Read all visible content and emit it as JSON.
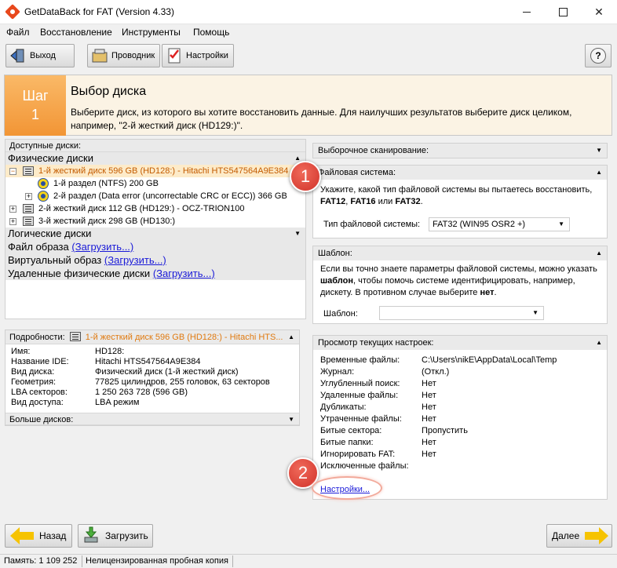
{
  "window": {
    "title": "GetDataBack for FAT (Version 4.33)"
  },
  "menu": [
    "Файл",
    "Восстановление",
    "Инструменты",
    "Помощь"
  ],
  "toolbar": {
    "exit_label": "Выход",
    "explorer_label": "Проводник",
    "settings_label": "Настройки",
    "help_label": "?"
  },
  "step": {
    "word": "Шаг",
    "number": "1",
    "title": "Выбор диска",
    "description": "Выберите диск, из которого вы хотите восстановить данные. Для наилучших результатов выберите диск целиком, например, \"2-й жесткий диск (HD129:)\"."
  },
  "disks": {
    "header": "Доступные диски:",
    "physical_header": "Физические диски",
    "items": [
      {
        "label": "1-й жесткий диск 596 GB (HD128:) - Hitachi HTS547564A9E384",
        "expander": "−"
      },
      {
        "label": "1-й раздел (NTFS) 200 GB"
      },
      {
        "label": "2-й раздел (Data error (uncorrectable CRC or ECC)) 366 GB",
        "expander": "+"
      },
      {
        "label": "2-й жесткий диск 112 GB (HD129:) - OCZ-TRION100",
        "expander": "+"
      },
      {
        "label": "3-й жесткий диск 298 GB (HD130:)",
        "expander": "+"
      }
    ],
    "logical_header": "Логические диски",
    "image_file_label": "Файл образа",
    "image_file_link": "(Загрузить...)",
    "virtual_image_label": "Виртуальный образ",
    "virtual_image_link": "(Загрузить...)",
    "remote_label": "Удаленные физические диски",
    "remote_link": "(Загрузить...)"
  },
  "details": {
    "header_label": "Подробности:",
    "header_value": "1-й жесткий диск 596 GB (HD128:) - Hitachi HTS...",
    "rows": [
      {
        "key": "Имя:",
        "value": "HD128:"
      },
      {
        "key": "Название IDE:",
        "value": "Hitachi HTS547564A9E384"
      },
      {
        "key": "Вид диска:",
        "value": "Физический диск (1-й жесткий диск)"
      },
      {
        "key": "Геометрия:",
        "value": "77825 цилиндров, 255 головок, 63 секторов"
      },
      {
        "key": "LBA секторов:",
        "value": "1 250 263 728 (596 GB)"
      },
      {
        "key": "Вид доступа:",
        "value": "LBA режим"
      }
    ],
    "more_disks": "Больше дисков:"
  },
  "right": {
    "selective_scan": "Выборочное сканирование:",
    "filesystem": {
      "header": "Файловая система:",
      "text_before": "Укажите, какой тип файловой системы вы пытаетесь восстановить,",
      "fat12": "FAT12",
      "fat16": "FAT16",
      "or": "или",
      "fat32": "FAT32",
      "type_label": "Тип файловой системы:",
      "type_value": "FAT32 (WIN95 OSR2 +)"
    },
    "template": {
      "header": "Шаблон:",
      "text_1": "Если вы точно знаете параметры файловой системы, можно указать",
      "bold": "шаблон",
      "text_2": ", чтобы помочь системе идентифицировать, например,",
      "text_3": "дискету. В противном случае выберите",
      "bold_no": "нет",
      "label": "Шаблон:",
      "value": ""
    },
    "current": {
      "header": "Просмотр текущих настроек:",
      "rows": [
        {
          "key": "Временные файлы:",
          "value": "C:\\Users\\nikE\\AppData\\Local\\Temp"
        },
        {
          "key": "Журнал:",
          "value": "(Откл.)"
        },
        {
          "key": "Углубленный поиск:",
          "value": "Нет"
        },
        {
          "key": "Удаленные файлы:",
          "value": "Нет"
        },
        {
          "key": "Дубликаты:",
          "value": "Нет"
        },
        {
          "key": "Утраченные файлы:",
          "value": "Нет"
        },
        {
          "key": "Битые сектора:",
          "value": "Пропустить"
        },
        {
          "key": "Битые папки:",
          "value": "Нет"
        },
        {
          "key": "Игнорировать FAT:",
          "value": "Нет"
        },
        {
          "key": "Исключенные файлы:",
          "value": ""
        }
      ],
      "settings_link": "Настройки..."
    }
  },
  "callouts": [
    "1",
    "2"
  ],
  "nav": {
    "back_label": "Назад",
    "load_label": "Загрузить",
    "next_label": "Далее"
  },
  "status": {
    "memory": "Память: 1 109 252",
    "license": "Нелицензированная пробная копия"
  },
  "colors": {
    "accent_orange": "#f29535",
    "link_blue": "#1a1ad8",
    "callout_red": "#d1322a",
    "selected_text": "#c35b00"
  }
}
